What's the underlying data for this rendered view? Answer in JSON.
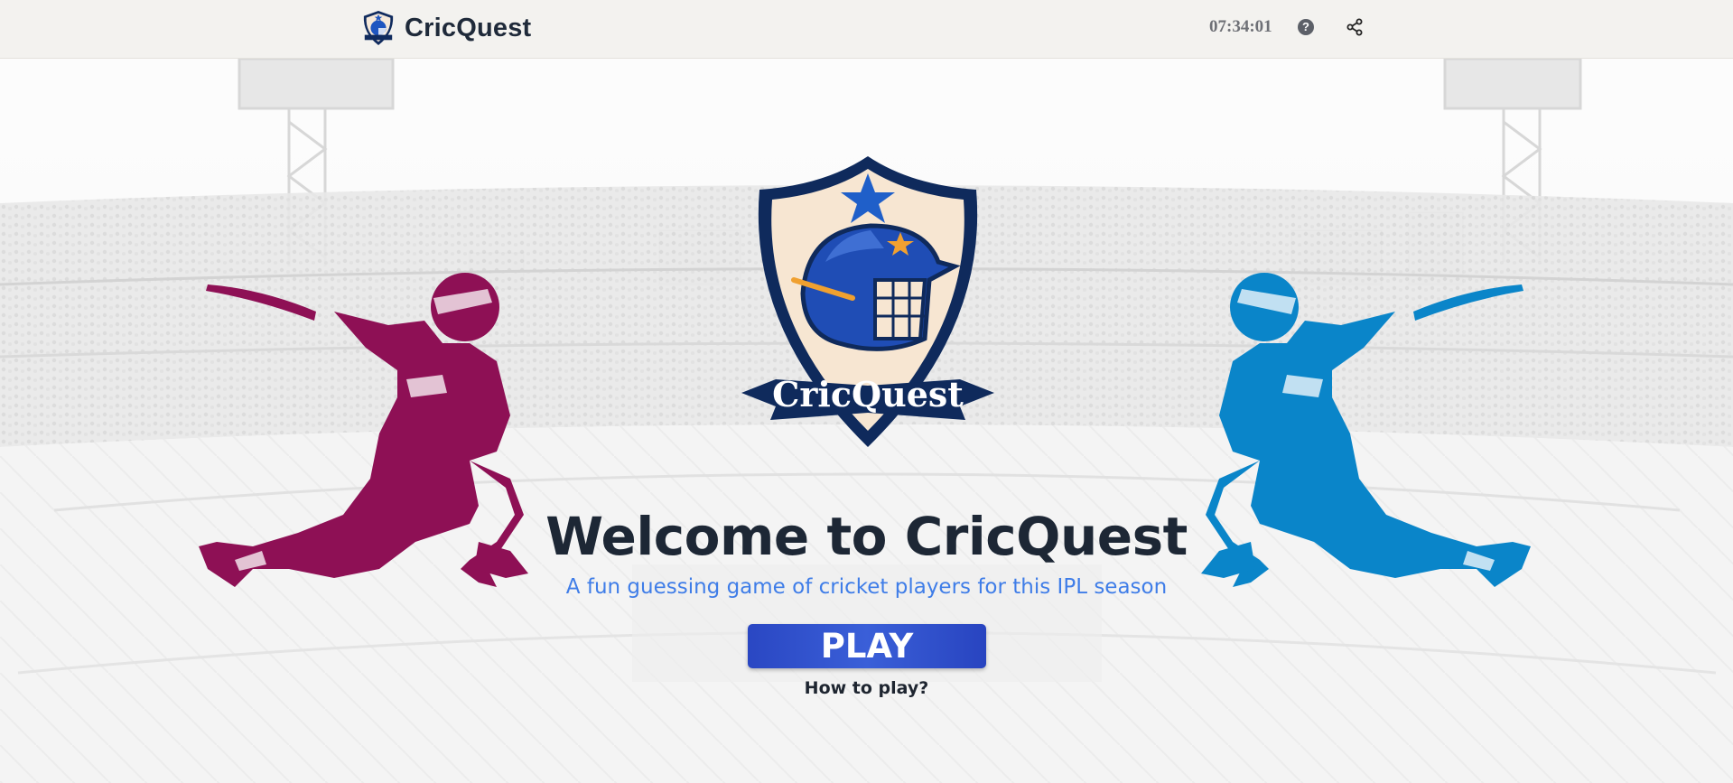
{
  "header": {
    "brand_name": "CricQuest",
    "timer": "07:34:01",
    "help_icon": "question-circle-icon",
    "share_icon": "share-icon"
  },
  "hero": {
    "logo_text": "CricQuest",
    "title": "Welcome to CricQuest",
    "subtitle": "A fun guessing game of cricket players for this IPL season",
    "play_label": "PLAY",
    "how_to_play_label": "How to play?"
  },
  "colors": {
    "topbar_bg": "#f3f2ef",
    "title": "#1d2735",
    "subtitle": "#3f7de8",
    "play_button": "#2f4ecb",
    "left_batter": "#8e1055",
    "right_batter": "#0a85c9",
    "logo_navy": "#0f2a5c"
  }
}
